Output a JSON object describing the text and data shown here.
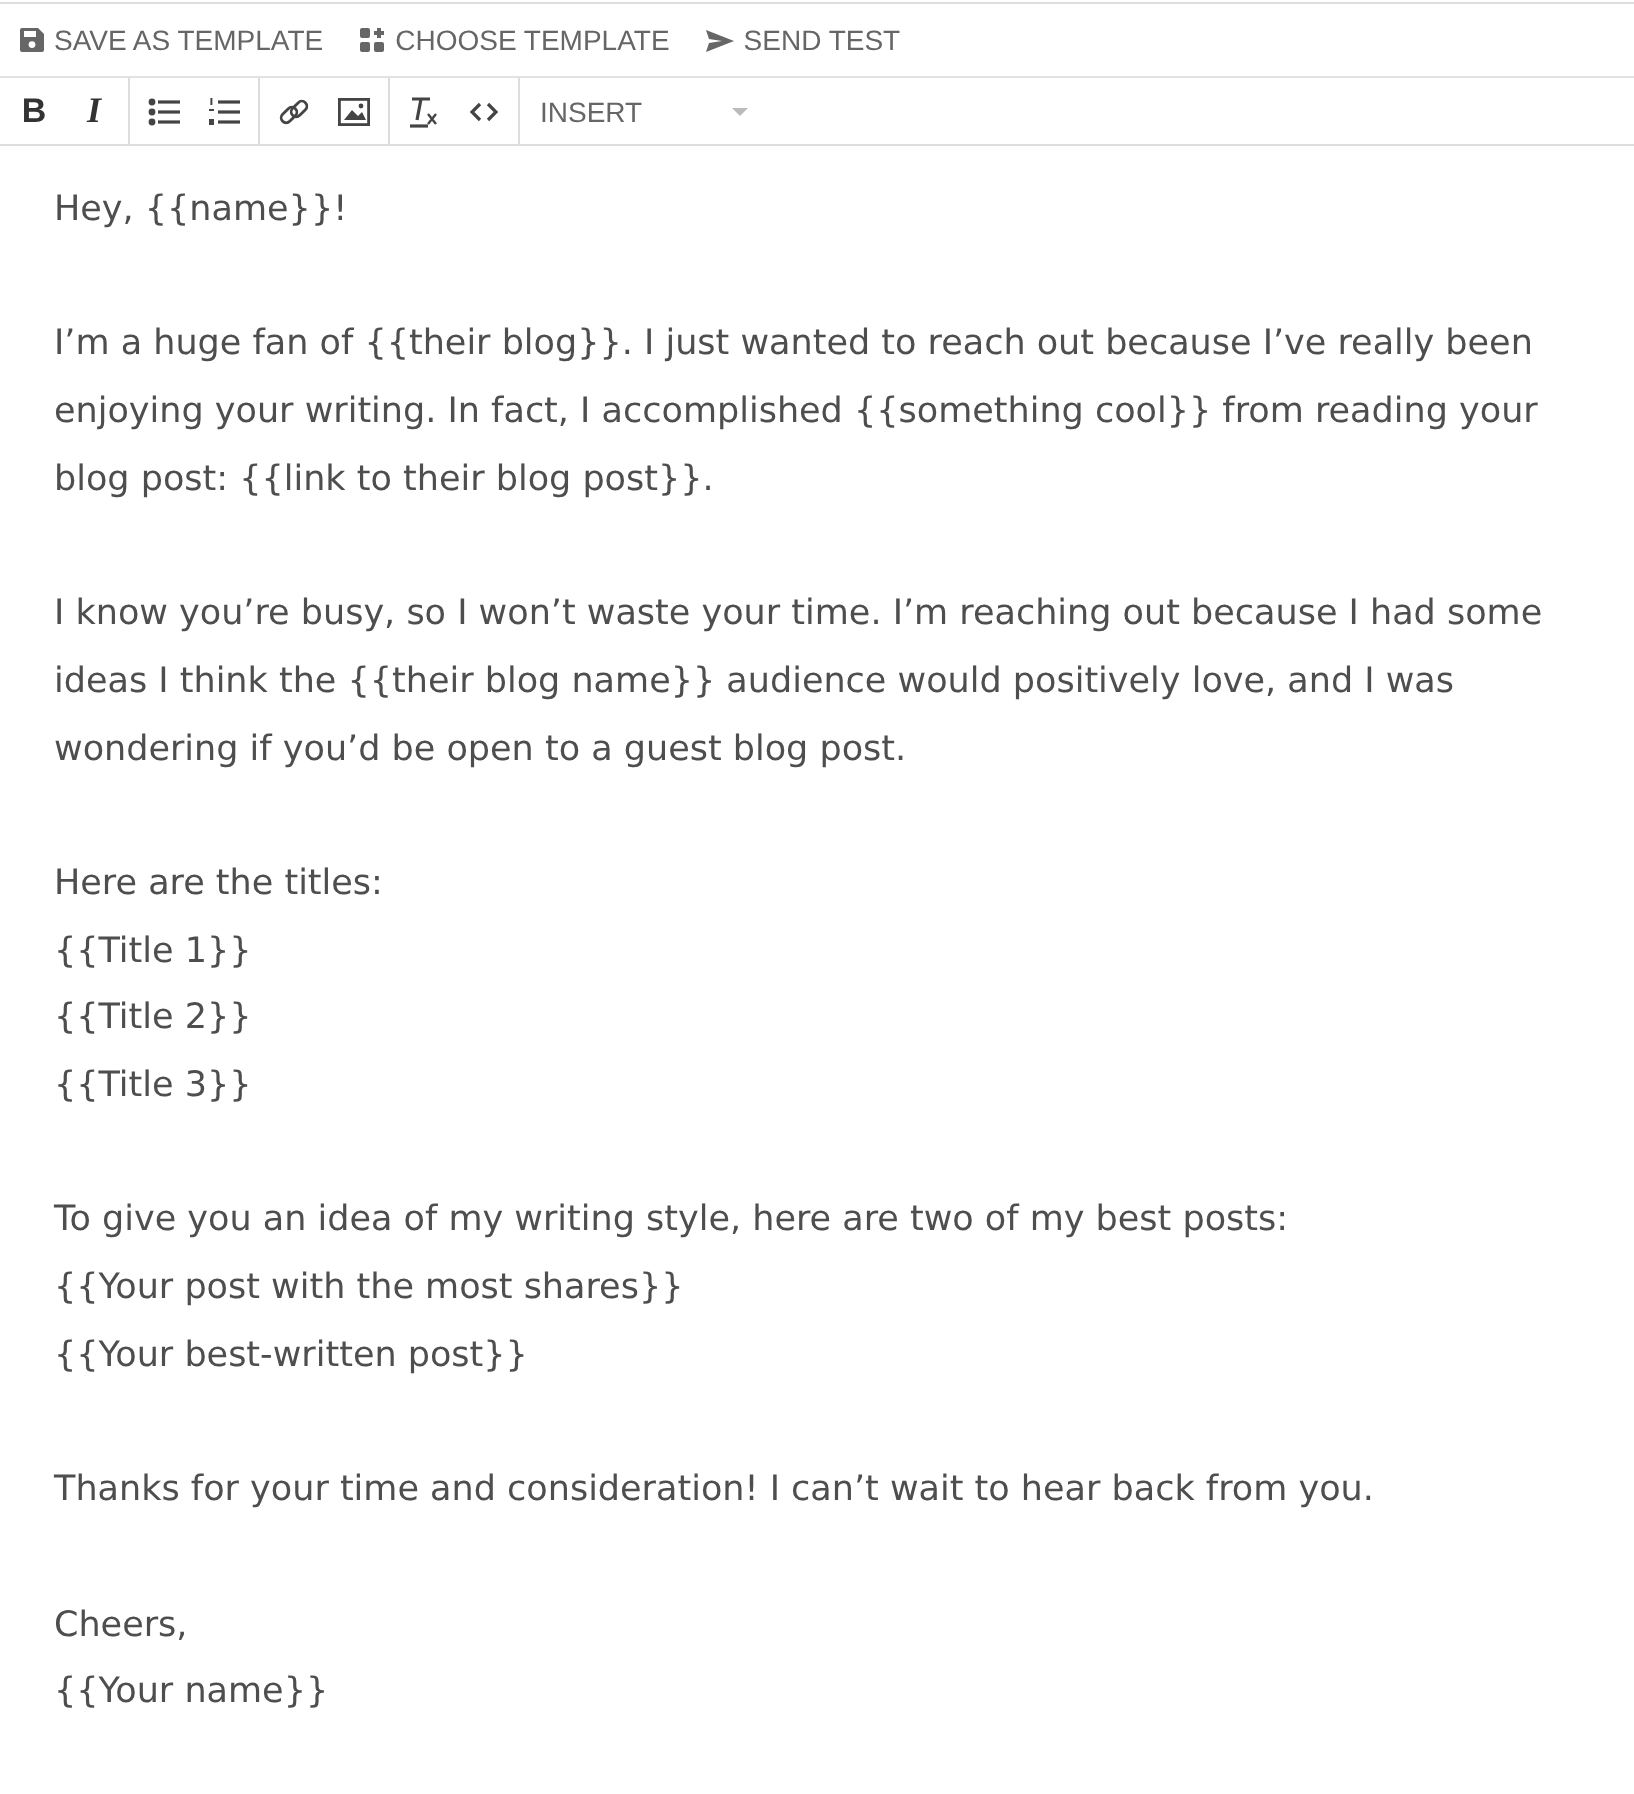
{
  "actions": [
    {
      "kind": "save",
      "label": "SAVE AS TEMPLATE"
    },
    {
      "kind": "choose",
      "label": "CHOOSE TEMPLATE"
    },
    {
      "kind": "send",
      "label": "SEND TEST"
    }
  ],
  "format_bar": {
    "groups": [
      [
        {
          "kind": "bold",
          "label": "B"
        },
        {
          "kind": "italic",
          "label": "I"
        }
      ],
      [
        {
          "kind": "bullets"
        },
        {
          "kind": "numbers"
        }
      ],
      [
        {
          "kind": "link"
        },
        {
          "kind": "image"
        }
      ],
      [
        {
          "kind": "clear"
        },
        {
          "kind": "code"
        }
      ]
    ],
    "insert": {
      "label": "INSERT"
    }
  },
  "body": [
    [
      "Hey, {{name}}!"
    ],
    [
      "I’m a huge fan of {{their blog}}. I just wanted to reach out because I’ve really been enjoying your writing. In fact, I accomplished {{something cool}} from reading your blog post: {{link to their blog post}}."
    ],
    [
      "I know you’re busy, so I won’t waste your time. I’m reaching out because I had some ideas I think the {{their blog name}} audience would positively love, and I was wondering if you’d be open to a guest blog post."
    ],
    [
      "Here are the titles:",
      "{{Title 1}}",
      "{{Title 2}}",
      "{{Title 3}}"
    ],
    [
      "To give you an idea of my writing style, here are two of my best posts:",
      "{{Your post with the most shares}}",
      "{{Your best-written post}}"
    ],
    [
      "Thanks for your time and consideration! I can’t wait to hear back from you."
    ],
    [
      "Cheers,",
      "{{Your name}}"
    ]
  ]
}
